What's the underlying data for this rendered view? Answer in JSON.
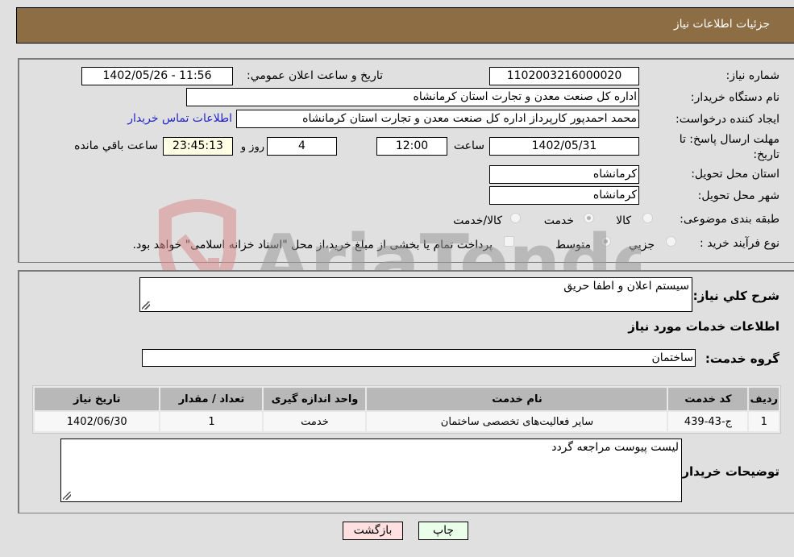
{
  "header": {
    "title": "جزئیات اطلاعات نیاز"
  },
  "form": {
    "need_number": {
      "label": "شماره نیاز:",
      "value": "1102003216000020"
    },
    "announce_datetime": {
      "label": "تاریخ و ساعت اعلان عمومي:",
      "value": "1402/05/26 - 11:56"
    },
    "buyer_org": {
      "label": "نام دستگاه خریدار:",
      "value": "اداره کل صنعت  معدن و تجارت استان کرمانشاه"
    },
    "requester": {
      "label": "ایجاد کننده درخواست:",
      "value": "محمد احمدپور کارپرداز اداره کل صنعت  معدن و تجارت استان کرمانشاه",
      "contact_link": "اطلاعات تماس خریدار"
    },
    "deadline": {
      "label": "مهلت ارسال پاسخ: تا تاریخ:",
      "date": "1402/05/31",
      "time_label": "ساعت",
      "time": "12:00",
      "days": "4",
      "days_label": "روز و",
      "remaining": "23:45:13",
      "remaining_label": "ساعت باقي مانده"
    },
    "delivery_province": {
      "label": "استان محل تحویل:",
      "value": "کرمانشاه"
    },
    "delivery_city": {
      "label": "شهر محل تحویل:",
      "value": "کرمانشاه"
    },
    "category": {
      "label": "طبقه بندی موضوعی:",
      "options": [
        "کالا",
        "خدمت",
        "کالا/خدمت"
      ],
      "selected": "خدمت"
    },
    "purchase_process": {
      "label": "نوع فرآیند خرید :",
      "options": [
        "جزیي",
        "متوسط"
      ],
      "selected": "متوسط",
      "treasury_note": "پرداخت تمام یا بخشی از مبلغ خرید،از محل \"اسناد خزانه اسلامی\" خواهد بود."
    }
  },
  "details": {
    "summary_label": "شرح کلي نیاز:",
    "summary_value": "سیستم اعلان و اطفا حریق",
    "services_heading": "اطلاعات خدمات مورد نیاز",
    "service_group_label": "گروه خدمت:",
    "service_group_value": "ساختمان",
    "table": {
      "headers": [
        "ردیف",
        "کد خدمت",
        "نام خدمت",
        "واحد اندازه گیری",
        "تعداد / مقدار",
        "تاریخ نیاز"
      ],
      "rows": [
        [
          "1",
          "ج-43-439",
          "سایر فعالیت‌های تخصصی ساختمان",
          "خدمت",
          "1",
          "1402/06/30"
        ]
      ]
    },
    "buyer_notes_label": "توضیحات خریدار:",
    "buyer_notes_value": "لیست پیوست مراجعه گردد"
  },
  "buttons": {
    "print": "چاپ",
    "back": "بازگشت"
  },
  "watermark": {
    "text": "AriaTender.neT"
  }
}
